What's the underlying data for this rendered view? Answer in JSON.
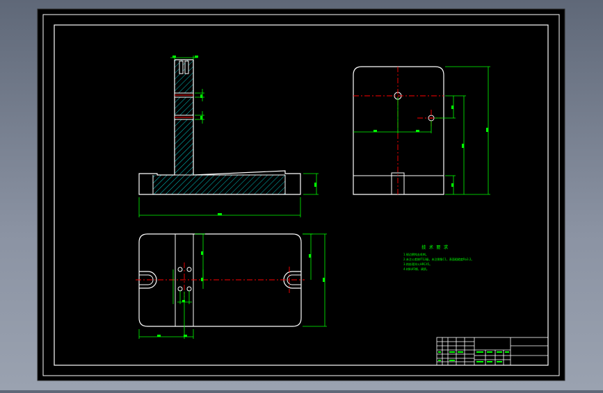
{
  "drawing": {
    "name": "fixture-base-engineering-drawing",
    "colors": {
      "background": "#000000",
      "outline": "#ffffff",
      "dimension": "#00ff00",
      "centerline": "#ff0000",
      "hatch": "#00c8c8"
    }
  },
  "tech_requirements": {
    "title": "技 术 要 求",
    "lines": [
      "1.锐边倒钝去毛刺。",
      "2.未注公差按IT12级，未注倒角C1，表面粗糙度Ra3.2。",
      "3.热处理淬火HRC45。",
      "4.材料45钢，调质。"
    ]
  }
}
